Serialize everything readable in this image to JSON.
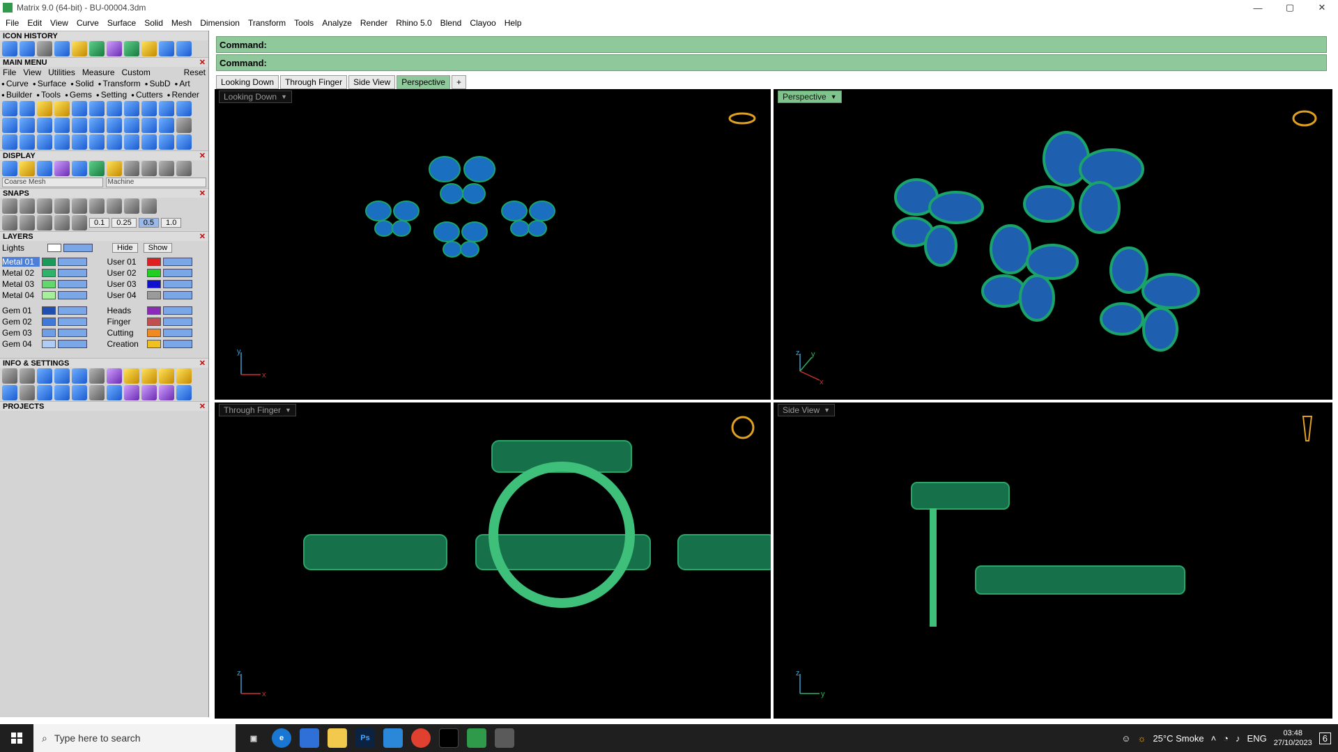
{
  "window": {
    "title": "Matrix 9.0 (64-bit) - BU-00004.3dm",
    "controls": [
      "—",
      "▢",
      "✕"
    ]
  },
  "menu": [
    "File",
    "Edit",
    "View",
    "Curve",
    "Surface",
    "Solid",
    "Mesh",
    "Dimension",
    "Transform",
    "Tools",
    "Analyze",
    "Render",
    "Rhino 5.0",
    "Blend",
    "Clayoo",
    "Help"
  ],
  "left": {
    "icon_history": "ICON HISTORY",
    "main_menu": "MAIN MENU",
    "submenu": [
      "File",
      "View",
      "Utilities",
      "Measure",
      "Custom",
      "Reset"
    ],
    "tags_row1": [
      "Curve",
      "Surface",
      "Solid",
      "Transform",
      "SubD",
      "Art"
    ],
    "tags_row2": [
      "Builder",
      "Tools",
      "Gems",
      "Setting",
      "Cutters",
      "Render"
    ],
    "display": "DISPLAY",
    "display_combo1": "Coarse Mesh",
    "display_combo2": "Machine",
    "snaps": "SNAPS",
    "snap_values": [
      "0.1",
      "0.25",
      "0.5",
      "1.0"
    ],
    "layers": "LAYERS",
    "lights": "Lights",
    "hide_label": "Hide",
    "show_label": "Show",
    "layer_left": [
      "Metal 01",
      "Metal 02",
      "Metal 03",
      "Metal 04",
      "Gem 01",
      "Gem 02",
      "Gem 03",
      "Gem 04"
    ],
    "layer_right": [
      "User 01",
      "User 02",
      "User 03",
      "User 04",
      "Heads",
      "Finger",
      "Cutting",
      "Creation"
    ],
    "info": "INFO & SETTINGS",
    "projects": "PROJECTS"
  },
  "command": {
    "line1": "Command:",
    "line2": "Command:"
  },
  "tabs": [
    "Looking Down",
    "Through Finger",
    "Side View",
    "Perspective",
    "+"
  ],
  "viewports": {
    "tl": "Looking Down",
    "tr": "Perspective",
    "bl": "Through Finger",
    "br": "Side View",
    "axis_tl": [
      "y",
      "x"
    ],
    "axis_tr": [
      "z",
      "y",
      "x"
    ],
    "axis_bl": [
      "z",
      "x"
    ],
    "axis_br": [
      "z",
      "y"
    ]
  },
  "taskbar": {
    "search": "Type here to search",
    "weather": "25°C  Smoke",
    "lang": "ENG",
    "time": "03:48",
    "date": "27/10/2023",
    "notif": "6"
  }
}
